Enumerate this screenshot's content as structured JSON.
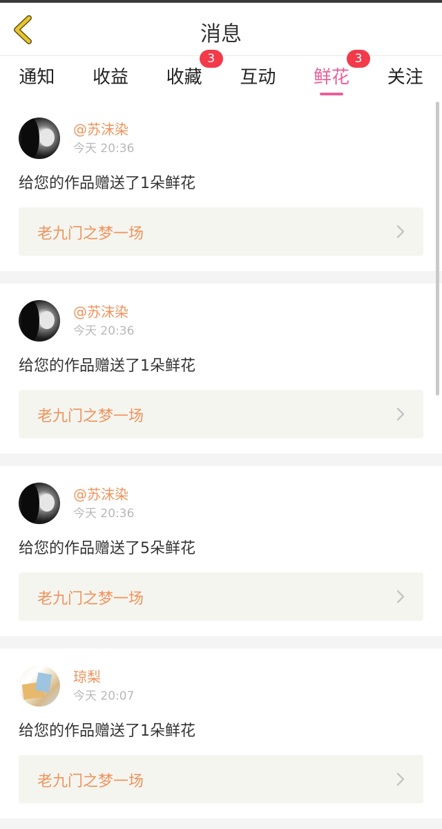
{
  "header": {
    "title": "消息",
    "back_icon": "chevron-left-icon",
    "back_color": "#e8c52b"
  },
  "tabs": [
    {
      "label": "通知",
      "badge": null,
      "active": false
    },
    {
      "label": "收益",
      "badge": null,
      "active": false
    },
    {
      "label": "收藏",
      "badge": "3",
      "active": false
    },
    {
      "label": "互动",
      "badge": null,
      "active": false
    },
    {
      "label": "鲜花",
      "badge": "3",
      "active": true
    },
    {
      "label": "关注",
      "badge": null,
      "active": false
    }
  ],
  "colors": {
    "accent": "#e8609a",
    "username": "#f0925a",
    "badge": "#f23a4a"
  },
  "messages": [
    {
      "user": "@苏沫染",
      "time": "今天 20:36",
      "text": "给您的作品赠送了1朵鲜花",
      "work": "老九门之梦一场",
      "avatar": "dark"
    },
    {
      "user": "@苏沫染",
      "time": "今天 20:36",
      "text": "给您的作品赠送了1朵鲜花",
      "work": "老九门之梦一场",
      "avatar": "dark"
    },
    {
      "user": "@苏沫染",
      "time": "今天 20:36",
      "text": "给您的作品赠送了5朵鲜花",
      "work": "老九门之梦一场",
      "avatar": "dark"
    },
    {
      "user": "琼梨",
      "time": "今天 20:07",
      "text": "给您的作品赠送了1朵鲜花",
      "work": "老九门之梦一场",
      "avatar": "light"
    }
  ]
}
